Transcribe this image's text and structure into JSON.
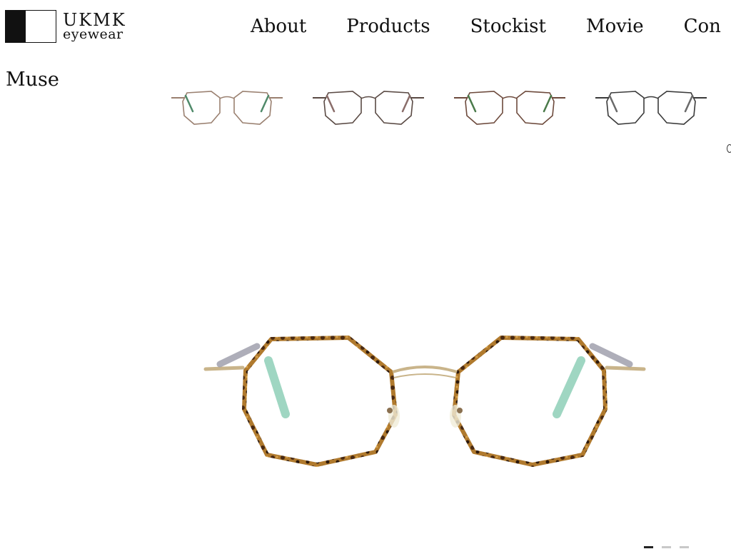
{
  "logo": {
    "brand": "UKMK",
    "sub": "eyewear",
    "icon": "black-white-square-logo"
  },
  "nav": {
    "items": [
      {
        "label": "About"
      },
      {
        "label": "Products"
      },
      {
        "label": "Stockist"
      },
      {
        "label": "Movie"
      },
      {
        "label": "Con"
      }
    ]
  },
  "product": {
    "title": "Muse"
  },
  "thumbnails": [
    {
      "variant": "thumbnail-1",
      "frame_color": "#9a8070",
      "temple_color": "#4f8a6a"
    },
    {
      "variant": "thumbnail-2",
      "frame_color": "#5a4a44",
      "temple_color": "#8a6d6a"
    },
    {
      "variant": "thumbnail-3",
      "frame_color": "#6d4a3c",
      "temple_color": "#4a7a4a"
    },
    {
      "variant": "thumbnail-4",
      "frame_color": "#3a3a3a",
      "temple_color": "#6a6a6a"
    }
  ],
  "main_image": {
    "icon": "round-eyeglasses-tortoise-gold",
    "rim_color": "#7a4a22",
    "metal_color": "#c9b48a",
    "temple_tip_color": "#8fd0b8"
  },
  "slider": {
    "dots": 3,
    "active_index": 0
  },
  "colors": {
    "background": "#ffffff",
    "text": "#111111",
    "dot_inactive": "#c8c8c8",
    "dot_active": "#222222"
  }
}
